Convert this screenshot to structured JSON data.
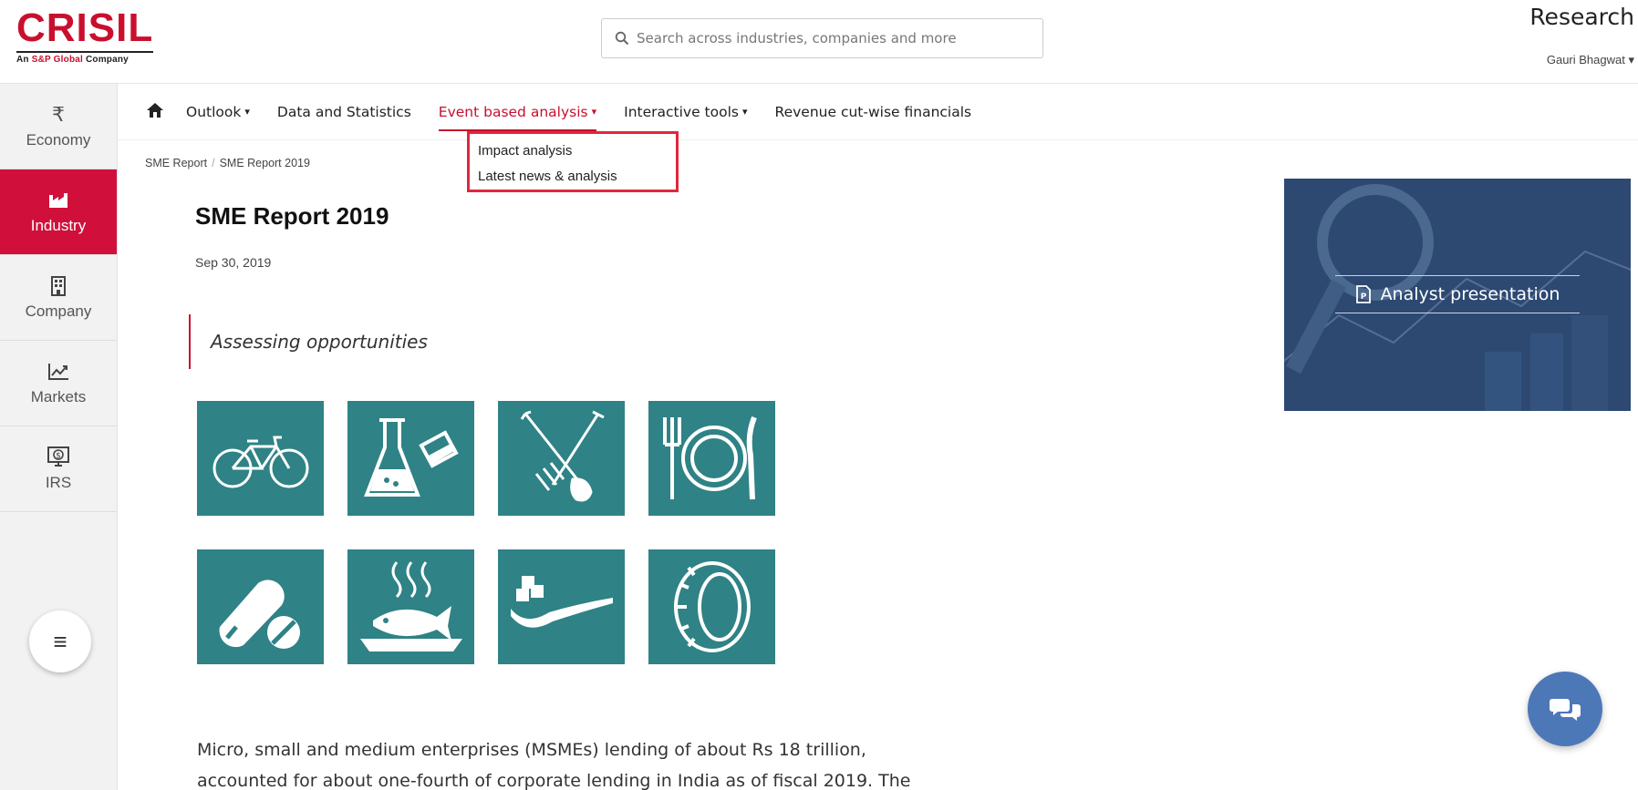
{
  "header": {
    "logo_text": "CRISIL",
    "logo_sub_prefix": "An ",
    "logo_sub_brand": "S&P Global",
    "logo_sub_suffix": " Company",
    "search_placeholder": "Search across industries, companies and more",
    "section": "Research",
    "user_name": "Gauri Bhagwat ▾"
  },
  "sidebar": {
    "items": [
      {
        "label": "Economy",
        "icon": "rupee-icon",
        "glyph": "₹"
      },
      {
        "label": "Industry",
        "icon": "factory-icon",
        "active": true
      },
      {
        "label": "Company",
        "icon": "building-icon"
      },
      {
        "label": "Markets",
        "icon": "chart-line-icon"
      },
      {
        "label": "IRS",
        "icon": "monitor-dollar-icon"
      }
    ],
    "menu_glyph": "≡"
  },
  "nav": {
    "items": [
      {
        "label": "Outlook",
        "caret": "▾"
      },
      {
        "label": "Data and Statistics"
      },
      {
        "label": "Event based analysis",
        "caret": "▾",
        "active": true
      },
      {
        "label": "Interactive tools",
        "caret": "▾"
      },
      {
        "label": "Revenue cut-wise financials"
      }
    ]
  },
  "dropdown": {
    "items": [
      "Impact analysis",
      "Latest news & analysis"
    ]
  },
  "breadcrumb": [
    "SME Report",
    "/",
    "SME Report 2019"
  ],
  "article": {
    "title": "SME Report 2019",
    "date": "Sep 30, 2019",
    "quote": "Assessing opportunities",
    "tiles": [
      "bicycle-icon",
      "chemistry-flask-icon",
      "agriculture-tools-icon",
      "food-plate-icon",
      "pharma-pills-icon",
      "fish-dish-icon",
      "sugar-spoon-icon",
      "tyre-icon"
    ],
    "body_line1": "Micro, small and medium enterprises (MSMEs) lending of about Rs 18 trillion,",
    "body_line2": "accounted for about one-fourth of corporate lending in India as of fiscal 2019. The"
  },
  "analyst": {
    "label": "Analyst presentation"
  },
  "colors": {
    "brand_red": "#c8102e",
    "tile_teal": "#2f8285",
    "analyst_bg": "#2e4a73",
    "chat_blue": "#4d78b8"
  }
}
